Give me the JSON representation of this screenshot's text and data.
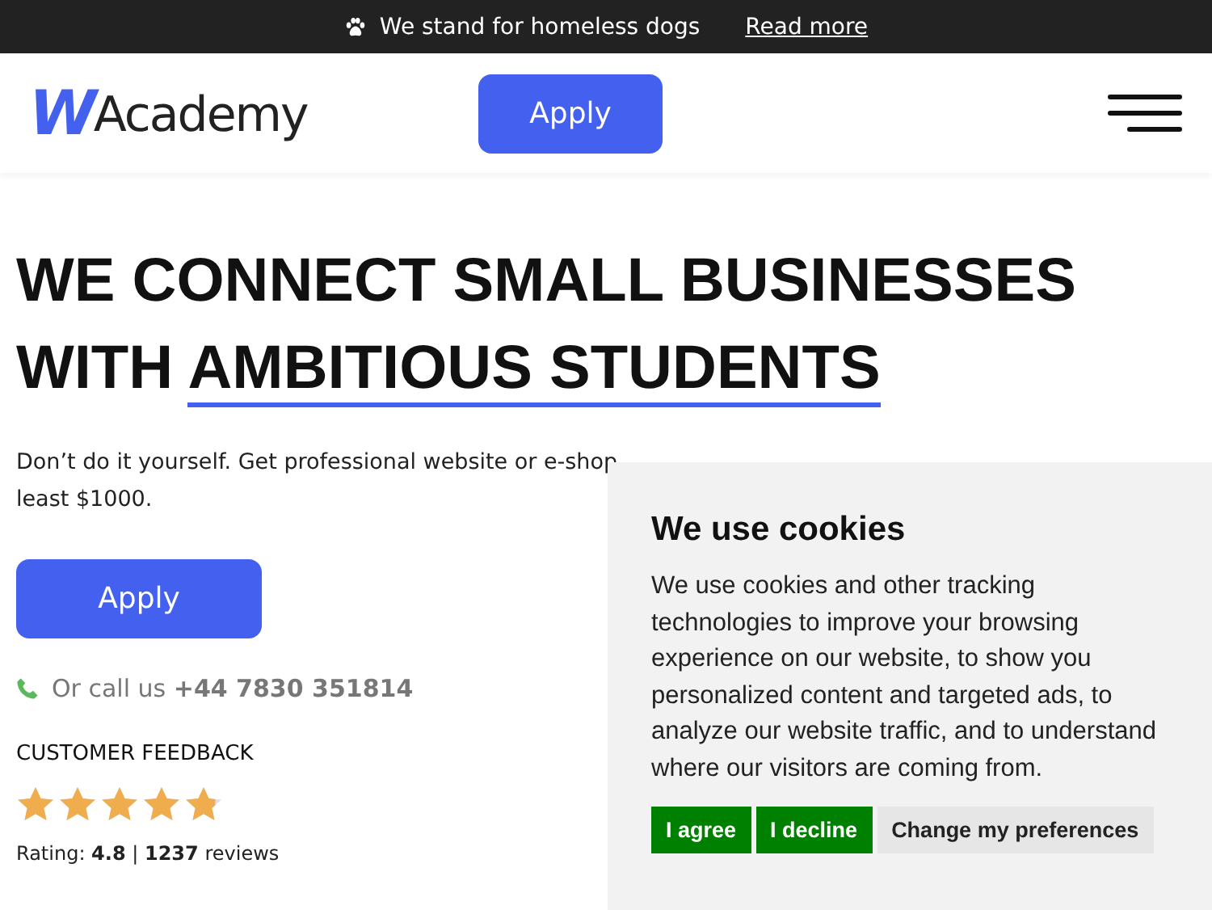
{
  "announcement": {
    "text": "We stand for homeless dogs",
    "link": "Read more"
  },
  "header": {
    "logo_letter": "W",
    "logo_text": "Academy",
    "apply_button": "Apply"
  },
  "hero": {
    "headline_line_1": "WE CONNECT SMALL BUSINESSES",
    "headline_line_2_start": "WITH ",
    "headline_line_2_underlined": "AMBITIOUS STUDENTS",
    "description_line_1": "Don’t do it yourself. Get professional website or e-shop",
    "description_line_2": "least $1000.",
    "apply_button": "Apply",
    "call": "Or call us **+44 7830 351814**",
    "feedback_title": "CUSTOMER FEEDBACK",
    "stars": 4.8,
    "rating": "Rating: **4.8** | **1237** reviews"
  },
  "cookie_banner": {
    "title": "We use cookies",
    "text": "We use cookies and other tracking technologies to improve your browsing experience on our website, to show you personalized content and targeted ads, to analyze our website traffic, and to understand where our visitors are coming from.",
    "buttons": [
      {
        "label": "I agree",
        "kind": "primary"
      },
      {
        "label": "I decline",
        "kind": "primary"
      },
      {
        "label": "Change my preferences",
        "kind": "secondary"
      }
    ]
  }
}
